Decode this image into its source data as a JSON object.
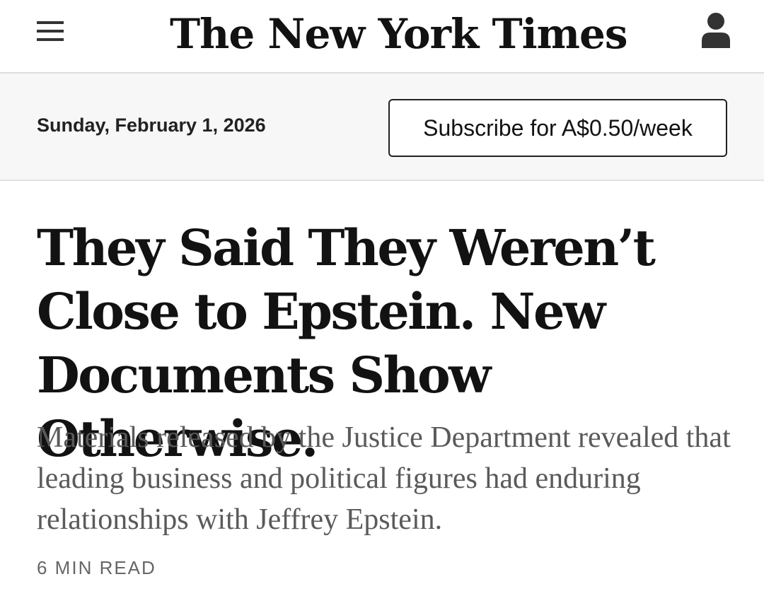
{
  "header": {
    "masthead": "The New York Times",
    "menu_icon": "hamburger-menu-icon",
    "account_icon": "user-account-icon"
  },
  "datebar": {
    "date": "Sunday, February 1, 2026",
    "subscribe_label": "Subscribe for A$0.50/week"
  },
  "article": {
    "headline": "They Said They Weren’t Close to Epstein. New Documents Show Otherwise.",
    "summary": "Materials released by the Justice Department revealed that leading business and political figures had enduring relationships with Jeffrey Epstein.",
    "read_time": "6 MIN READ"
  },
  "colors": {
    "text_primary": "#121212",
    "text_secondary": "#5a5a5a",
    "datebar_background": "#f7f7f7",
    "divider": "#dcdcdc"
  }
}
